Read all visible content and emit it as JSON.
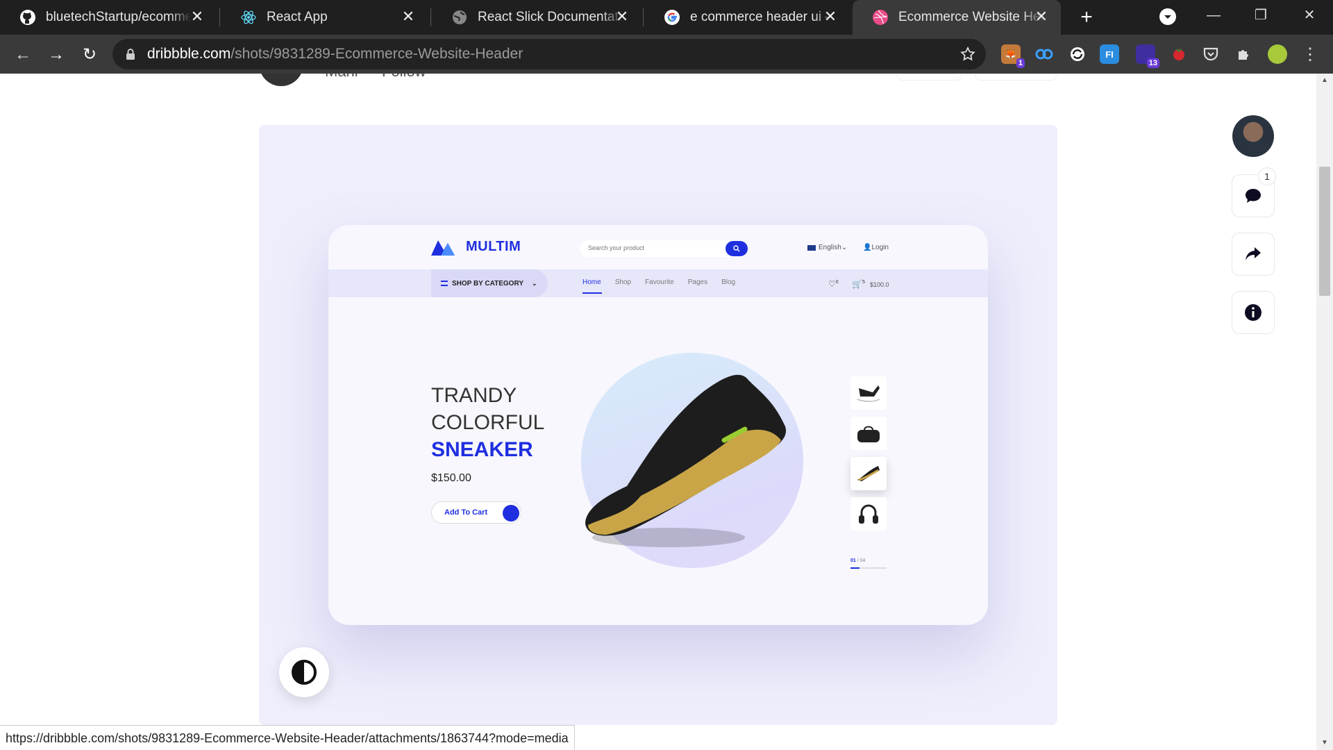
{
  "tabs": [
    {
      "label": "bluetechStartup/ecommerce",
      "icon": "github-icon"
    },
    {
      "label": "React App",
      "icon": "react-icon"
    },
    {
      "label": "React Slick Documentation",
      "icon": "globe-icon"
    },
    {
      "label": "e commerce header ui – R",
      "icon": "google-icon"
    },
    {
      "label": "Ecommerce Website Header",
      "icon": "dribbble-icon",
      "active": true
    }
  ],
  "address": {
    "host": "dribbble.com",
    "path": "/shots/9831289-Ecommerce-Website-Header"
  },
  "extensions": [
    {
      "name": "ext-1",
      "badge": "1"
    },
    {
      "name": "ext-2"
    },
    {
      "name": "ext-3"
    },
    {
      "name": "ext-4"
    },
    {
      "name": "ext-5",
      "badge": "13"
    },
    {
      "name": "ext-6"
    },
    {
      "name": "ext-7"
    },
    {
      "name": "ext-8"
    }
  ],
  "header_ghost": {
    "author": "Mahi",
    "follow": "Follow"
  },
  "mockup": {
    "logo": "MULTIM",
    "search_placeholder": "Search your product",
    "language": "English",
    "login": "Login",
    "shop_by_category": "SHOP BY CATEGORY",
    "menu": [
      "Home",
      "Shop",
      "Favourite",
      "Pages",
      "Blog"
    ],
    "wish_count": "0",
    "cart_count": "5",
    "cart_total": "$100.0",
    "hero_line1": "TRANDY",
    "hero_line2": "COLORFUL",
    "hero_line3": "SNEAKER",
    "price": "$150.00",
    "add_to_cart": "Add To Cart",
    "pager_current": "01",
    "pager_total": "/ 04"
  },
  "sidebar": {
    "comment_count": "1"
  },
  "status_url": "https://dribbble.com/shots/9831289-Ecommerce-Website-Header/attachments/1863744?mode=media",
  "colors": {
    "accent": "#1f2fe0",
    "shot_bg": "#eeeefc",
    "chrome_dark": "#1f1f1f"
  }
}
